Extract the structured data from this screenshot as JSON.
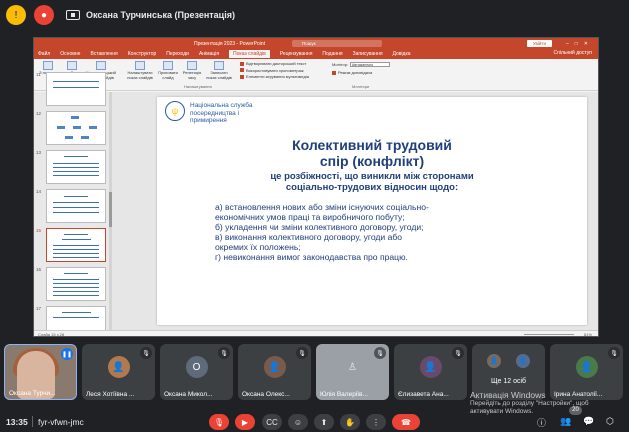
{
  "topbar": {
    "presenter_title": "Оксана Турчинська (Презентація)"
  },
  "pp": {
    "window_title": "Презентація 2023 - PowerPoint",
    "search_placeholder": "Пошук",
    "user_button": "Увійти",
    "share": "Спільний доступ",
    "tabs": [
      "Файл",
      "Основне",
      "Вставлення",
      "Конструктор",
      "Переходи",
      "Анімація",
      "Показ слайдів",
      "Рецензування",
      "Подання",
      "Записування",
      "Довідка"
    ],
    "active_tab": "Показ слайдів",
    "ribbon": {
      "start_group": [
        "З початку",
        "З поточного слайда",
        "Користувацький показ слайдів"
      ],
      "start_group_label": "Почати показ слайдів",
      "setup_group": [
        "Налаштувати показ слайдів",
        "Приховати слайд",
        "Репетиція часу",
        "Записати показ слайдів"
      ],
      "setup_group_label": "Налаштування",
      "checks": [
        {
          "label": "Відтворювати дикторський текст",
          "on": true
        },
        {
          "label": "Використовувати хронометраж",
          "on": true
        },
        {
          "label": "Елементи керування мультимедіа",
          "on": true
        }
      ],
      "monitor_label": "Монітор:",
      "monitor_value": "Автоматично",
      "presenter_mode": "Режим доповідача",
      "monitors_group_label": "Монітори"
    },
    "thumb_numbers": [
      "11",
      "12",
      "13",
      "14",
      "15",
      "16",
      "17"
    ],
    "selected_thumb": "15",
    "status": {
      "slide_info": "Слайд 15 з 28",
      "zoom": "81%"
    }
  },
  "slide": {
    "org_line1": "Національна служба",
    "org_line2": "посередництва і",
    "org_line3": "примирення",
    "title_line1": "Колективний трудовий",
    "title_line2": "спір (конфлікт)",
    "sub_line1": "це розбіжності, що виникли між сторонами",
    "sub_line2": "соціально-трудових відносин щодо:",
    "item_a1": "а) встановлення нових або зміни існуючих соціально-",
    "item_a2": "економічних умов праці та виробничого побуту;",
    "item_b": "б) укладення чи зміни колективного договору, угоди;",
    "item_c1": "в) виконання колективного договору, угоди або",
    "item_c2": "окремих їх положень;",
    "item_d": "г) невиконання вимог законодавства про працю."
  },
  "participants": [
    {
      "name": "Оксана Турчи...",
      "type": "self"
    },
    {
      "name": "Леся Хотіївна ...",
      "type": "avatar",
      "color": "#b07a50"
    },
    {
      "name": "Оксана Микол...",
      "type": "letter",
      "letter": "О",
      "color": "#5f6b7a"
    },
    {
      "name": "Оксана Олекс...",
      "type": "avatar",
      "color": "#7a5a4a"
    },
    {
      "name": "Юлія Валеріїв...",
      "type": "grey"
    },
    {
      "name": "Єлизавета Ана...",
      "type": "avatar",
      "color": "#6a4a6a"
    },
    {
      "name": "Ще 12 осіб",
      "type": "more",
      "count": "12"
    },
    {
      "name": "Ірина Анатолії...",
      "type": "avatar",
      "color": "#4a7a4a"
    }
  ],
  "watermark": {
    "line1": "Активація Windows",
    "line2": "Перейдіть до розділу \"Настройки\", щоб",
    "line3": "активувати Windows."
  },
  "bottombar": {
    "time": "13:35",
    "meeting_code": "fyr-vfwn-jmc",
    "participant_badge": "20"
  },
  "colors": {
    "accent_red": "#ea4335",
    "pp_brand": "#c4462b",
    "slide_blue": "#1f3f7a"
  }
}
